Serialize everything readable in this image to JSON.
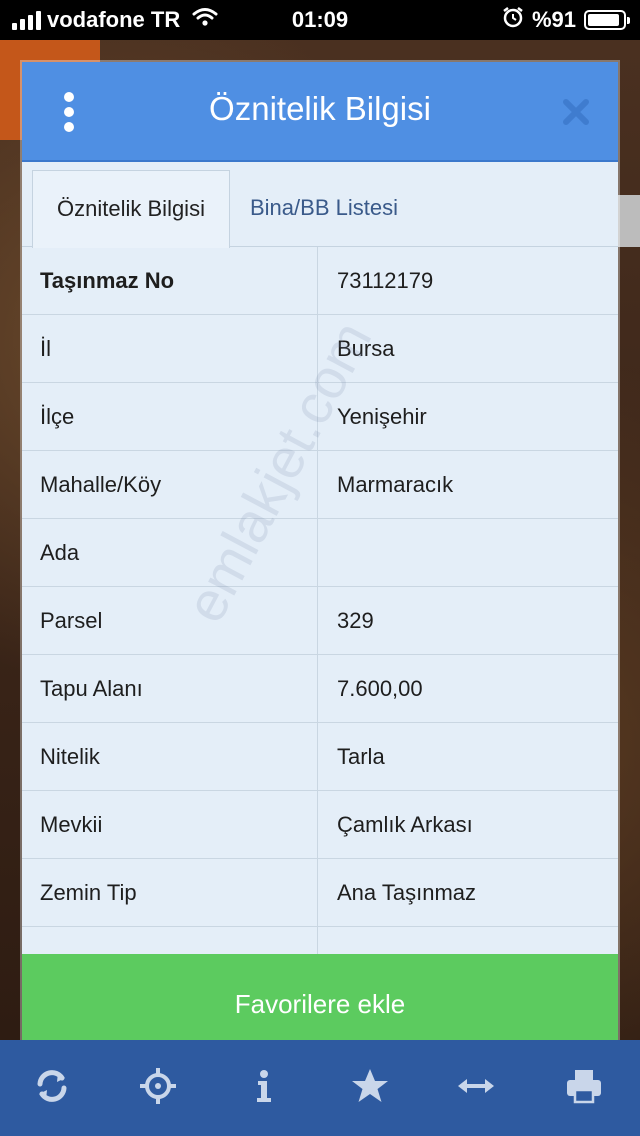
{
  "status_bar": {
    "carrier": "vodafone TR",
    "time": "01:09",
    "battery": "%91",
    "battery_level": 0.91
  },
  "modal": {
    "title": "Öznitelik Bilgisi",
    "tabs": [
      {
        "label": "Öznitelik Bilgisi",
        "active": true
      },
      {
        "label": "Bina/BB Listesi",
        "active": false
      }
    ],
    "rows": [
      {
        "label": "Taşınmaz No",
        "value": "73112179"
      },
      {
        "label": "İl",
        "value": "Bursa"
      },
      {
        "label": "İlçe",
        "value": "Yenişehir"
      },
      {
        "label": "Mahalle/Köy",
        "value": "Marmaracık"
      },
      {
        "label": "Ada",
        "value": ""
      },
      {
        "label": "Parsel",
        "value": "329"
      },
      {
        "label": "Tapu Alanı",
        "value": "7.600,00"
      },
      {
        "label": "Nitelik",
        "value": "Tarla"
      },
      {
        "label": "Mevkii",
        "value": "Çamlık Arkası"
      },
      {
        "label": "Zemin Tip",
        "value": "Ana Taşınmaz"
      }
    ],
    "favorite_button": "Favorilere ekle",
    "watermark": "emlakjet.com"
  },
  "toolbar": {
    "icons": [
      "refresh-icon",
      "crosshair-icon",
      "info-icon",
      "star-icon",
      "swap-arrows-icon",
      "print-icon"
    ]
  },
  "colors": {
    "header": "#4f8fe3",
    "favorite": "#5ccb5f",
    "toolbar": "#2e5aa0"
  }
}
